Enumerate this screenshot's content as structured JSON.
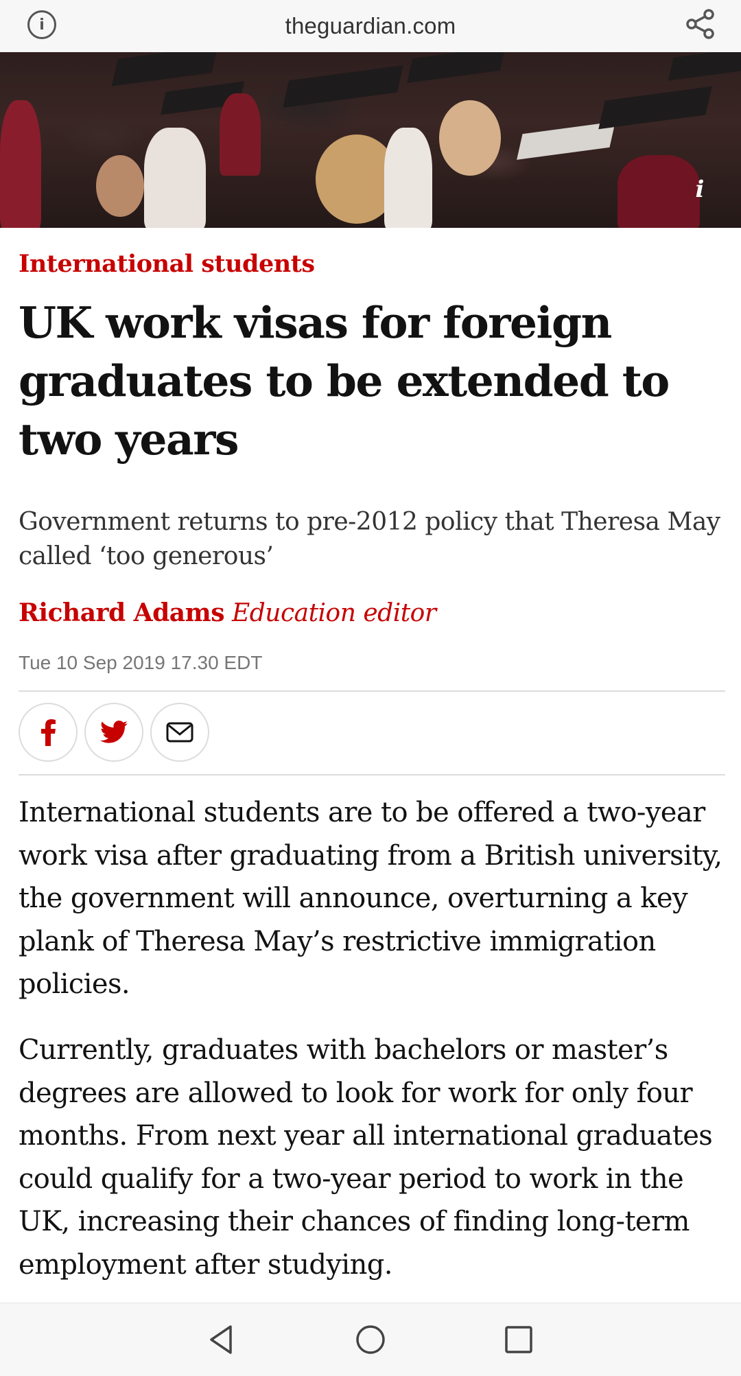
{
  "browser": {
    "url": "theguardian.com",
    "info_icon": "info-icon",
    "share_icon": "share-icon"
  },
  "hero": {
    "info_glyph": "i"
  },
  "article": {
    "kicker": "International students",
    "headline": "UK work visas for foreign graduates to be extended to two years",
    "standfirst": "Government returns to pre-2012 policy that Theresa May called ‘too generous’",
    "byline": {
      "name": "Richard Adams",
      "role": "Education editor"
    },
    "date": "Tue 10 Sep 2019 17.30 EDT",
    "share_buttons": [
      {
        "name": "facebook",
        "icon": "facebook-icon"
      },
      {
        "name": "twitter",
        "icon": "twitter-icon"
      },
      {
        "name": "email",
        "icon": "email-icon"
      }
    ],
    "paragraphs": [
      "International students are to be offered a two-year work visa after graduating from a British university, the government will announce, overturning a key plank of Theresa May’s restrictive immigration policies.",
      "Currently, graduates with bachelors or master’s degrees are allowed to look for work for only four months. From next year all international graduates could qualify for a two-year period to work in the UK, increasing their chances of finding long-term employment after studying."
    ]
  },
  "navbar": {
    "buttons": [
      "back-icon",
      "home-icon",
      "recents-icon"
    ]
  },
  "colors": {
    "accent": "#c70000",
    "text": "#121212",
    "muted": "#767676"
  }
}
